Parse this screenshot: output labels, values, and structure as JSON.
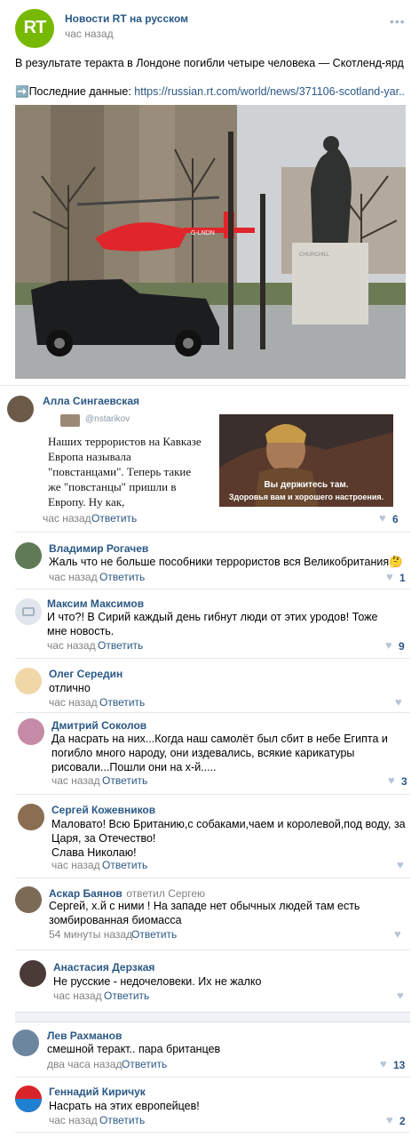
{
  "post": {
    "author": "Новости RT на русском",
    "time": "час назад",
    "logo": "RT",
    "text": "В результате теракта в Лондоне погибли четыре человека — Скотленд-ярд",
    "link_prefix": "➡️Последние данные: ",
    "link": "https://russian.rt.com/world/news/371106-scotland-yar..",
    "helicopter_reg": "G-LNDN",
    "statue_inscription": "CHURCHILL"
  },
  "comments": [
    {
      "author": "Алла Сингаевская",
      "time": "час назад",
      "reply": "Ответить",
      "likes": "6",
      "tweet_handle": "@nstarikov",
      "tweet_text": "Наших террористов на Кавказе Европа называла \"повстанцами\". Теперь такие же \"повстанцы\" пришли в Европу. Ну как,",
      "meme_line1": "Вы держитесь там.",
      "meme_line2": "Здоровья вам и хорошего настроения."
    },
    {
      "author": "Владимир Рогачев",
      "time": "час назад",
      "reply": "Ответить",
      "likes": "1",
      "text": "Жаль что не больше пособники террористов вся Великобритания🤔"
    },
    {
      "author": "Максим Максимов",
      "time": "час назад",
      "reply": "Ответить",
      "likes": "9",
      "text": "И что?! В Сирий каждый день гибнут люди от этих уродов! Тоже мне новость."
    },
    {
      "author": "Олег Середин",
      "time": "час назад",
      "reply": "Ответить",
      "likes": "",
      "text": "отлично"
    },
    {
      "author": "Дмитрий Соколов",
      "time": "час назад",
      "reply": "Ответить",
      "likes": "3",
      "text": "Да насрать на них...Когда наш самолёт был сбит в небе Египта и погибло много народу, они издевались, всякие карикатуры рисовали...Пошли они на х-й....."
    },
    {
      "author": "Сергей Кожевников",
      "time": "час назад",
      "reply": "Ответить",
      "likes": "",
      "text": "Маловато! Всю Британию,с собаками,чаем и королевой,под воду, за Царя, за Отечество!",
      "text2": "Слава Николаю!"
    },
    {
      "author": "Аскар Баянов",
      "replied": "ответил Сергею",
      "time": "54 минуты назад",
      "reply": "Ответить",
      "likes": "",
      "text": "Сергей, х.й с ними ! На западе нет обычных людей там есть зомбированная биомасса"
    },
    {
      "author": "Анастасия Дерзкая",
      "time": "час назад",
      "reply": "Ответить",
      "likes": "",
      "text": "Не русские - недочеловеки. Их не жалко"
    },
    {
      "author": "Лев Рахманов",
      "time": "два часа назад",
      "reply": "Ответить",
      "likes": "13",
      "text": "смешной теракт.. пара британцев"
    },
    {
      "author": "Геннадий Киричук",
      "time": "час назад",
      "reply": "Ответить",
      "likes": "2",
      "text": "Насрать на этих европейцев!"
    }
  ],
  "colors": {
    "link": "#2a5885",
    "rt_green": "#77b800",
    "heart": "#b8c5d6",
    "separator": "#e7e8ec"
  }
}
